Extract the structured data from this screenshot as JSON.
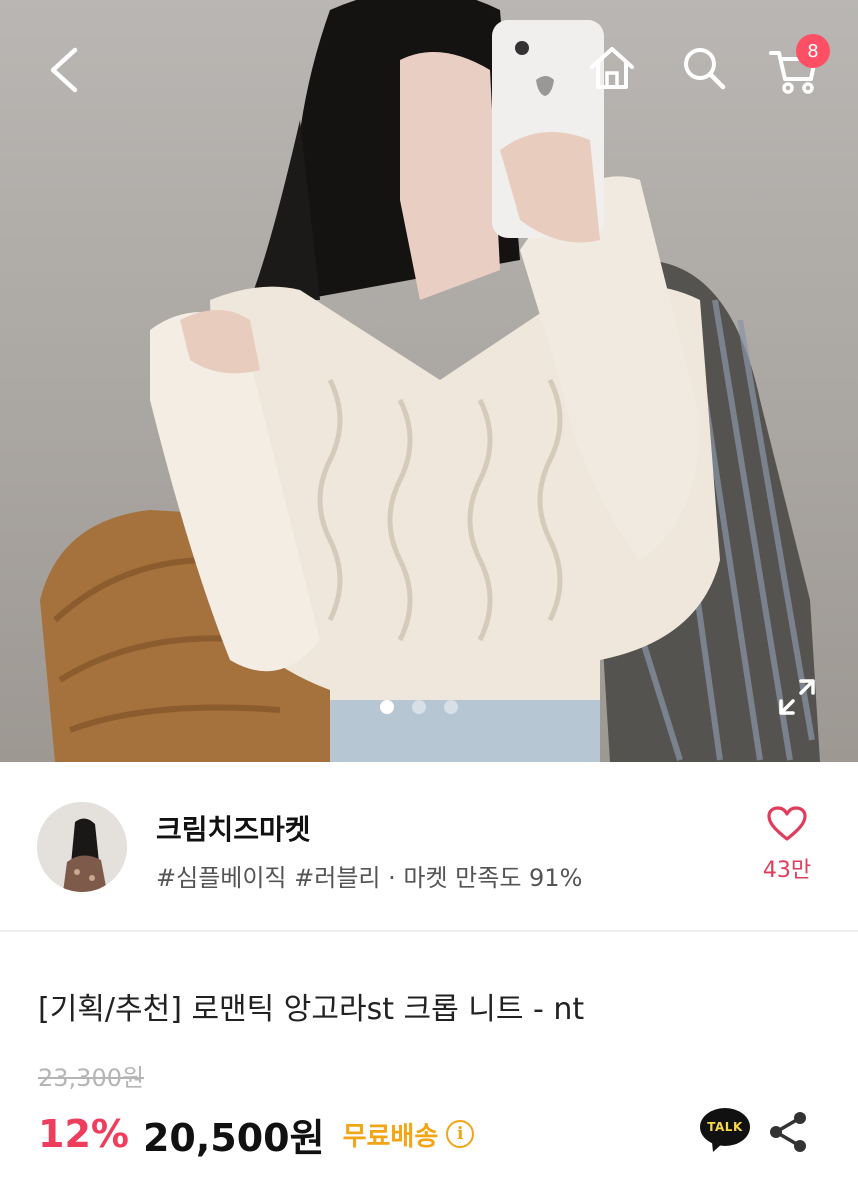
{
  "header": {
    "back_icon": "chevron-left-icon",
    "home_icon": "home-icon",
    "search_icon": "search-icon",
    "cart_icon": "cart-icon",
    "cart_badge": "8"
  },
  "gallery": {
    "slides": 3,
    "active_slide": 1,
    "expand_icon": "expand-icon"
  },
  "shop": {
    "name": "크림치즈마켓",
    "tags": "#심플베이직 #러블리 · 마켓 만족도 91%",
    "like_icon": "heart-icon",
    "like_count": "43만"
  },
  "product": {
    "title": "[기획/추천] 로맨틱 앙고라st 크롭 니트 - nt",
    "original_price": "23,300원",
    "discount": "12%",
    "price": "20,500원",
    "shipping": "무료배송",
    "info_icon": "i"
  },
  "actions": {
    "talk_label": "TALK",
    "share_icon": "share-icon"
  },
  "colors": {
    "accent_red": "#ef3d5e",
    "badge": "#ff4f64",
    "shipping": "#f2a516",
    "like": "#e23c5d"
  }
}
